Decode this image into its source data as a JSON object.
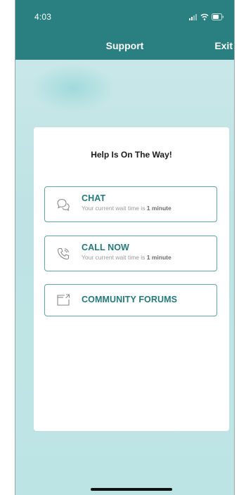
{
  "status_bar": {
    "time": "4:03",
    "icons": [
      "signal-icon",
      "wifi-icon",
      "battery-icon"
    ]
  },
  "header": {
    "title": "Support",
    "exit_label": "Exit"
  },
  "card": {
    "title": "Help Is On The Way!",
    "options": [
      {
        "label": "CHAT",
        "icon": "chat-bubbles-icon",
        "subtitle_prefix": "Your current wait time is",
        "subtitle_value": "1 minute"
      },
      {
        "label": "CALL NOW",
        "icon": "phone-icon",
        "subtitle_prefix": "Your current wait time is",
        "subtitle_value": "1 minute"
      },
      {
        "label": "COMMUNITY FORUMS",
        "icon": "external-window-icon"
      }
    ]
  },
  "colors": {
    "header_bg": "#2a7f80",
    "accent": "#23797b",
    "option_border": "#5fa7a7",
    "background": "#bfe3e4"
  }
}
